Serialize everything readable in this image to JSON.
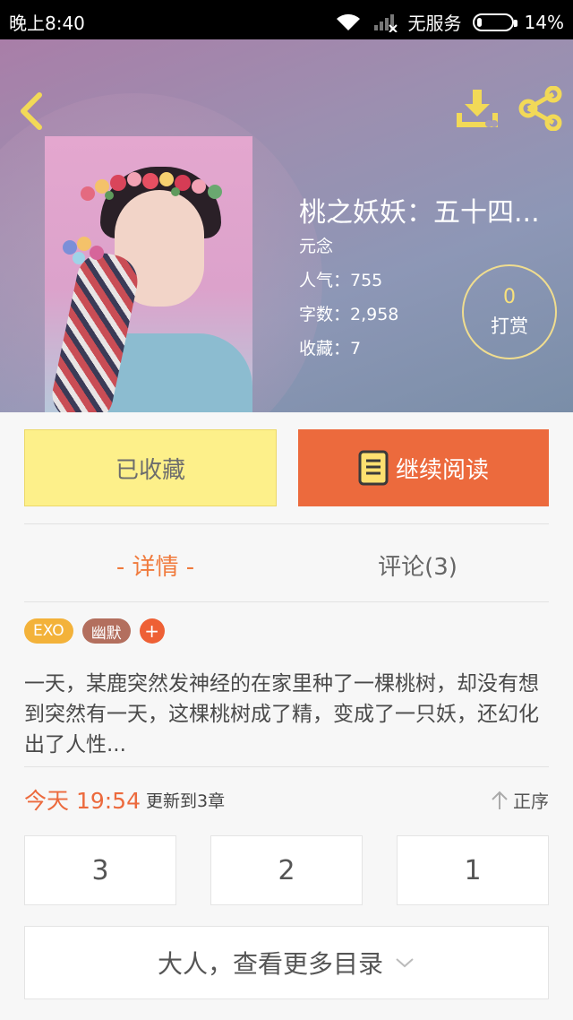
{
  "status_bar": {
    "time": "晚上8:40",
    "carrier": "无服务",
    "battery_text": "14%",
    "battery_level": 0.14
  },
  "header": {
    "title": "桃之妖妖：五十四...",
    "author": "元念",
    "popularity": "人气：755",
    "word_count": "字数：2,958",
    "favorites": "收藏：7",
    "tip_count": "0",
    "tip_label": "打赏"
  },
  "actions": {
    "collected_label": "已收藏",
    "continue_label": "继续阅读"
  },
  "tabs": {
    "detail_label": "- 详情 -",
    "comments_label": "评论(3)"
  },
  "tags": [
    {
      "label": "EXO",
      "color": "#f3b23a"
    },
    {
      "label": "幽默",
      "color": "#b36f5e"
    },
    {
      "label": "+",
      "color": "#ee6035"
    }
  ],
  "description": "一天，某鹿突然发神经的在家里种了一棵桃树，却没有想到突然有一天，这棵桃树成了精，变成了一只妖，还幻化出了人性...",
  "update": {
    "date": "今天 19:54",
    "text": "更新到3章",
    "sort_label": "正序"
  },
  "chapters": [
    "3",
    "2",
    "1"
  ],
  "more_label": "大人，查看更多目录",
  "colors": {
    "accent": "#ec6a3d",
    "collected_bg": "#fdf08a",
    "icon_yellow": "#f2d957"
  }
}
